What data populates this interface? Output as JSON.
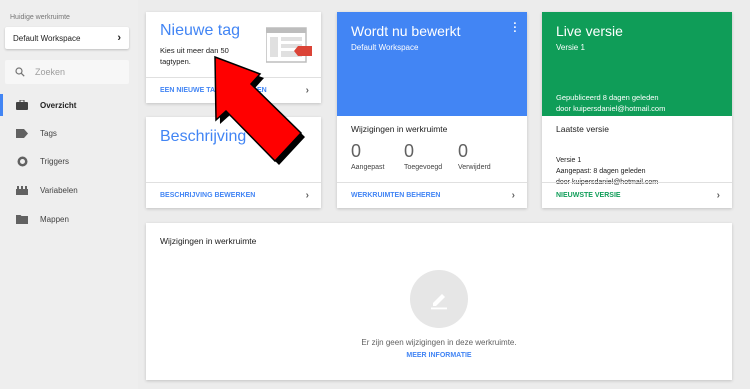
{
  "sidebar": {
    "workspace_label": "Huidige werkruimte",
    "workspace_name": "Default Workspace",
    "search_placeholder": "Zoeken",
    "items": [
      {
        "label": "Overzicht",
        "icon": "briefcase-icon"
      },
      {
        "label": "Tags",
        "icon": "tag-icon"
      },
      {
        "label": "Triggers",
        "icon": "trigger-icon"
      },
      {
        "label": "Variabelen",
        "icon": "variables-icon"
      },
      {
        "label": "Mappen",
        "icon": "folder-icon"
      }
    ]
  },
  "new_tag": {
    "title": "Nieuwe tag",
    "description": "Kies uit meer dan 50 tagtypen.",
    "footer": "EEN NIEUWE TAG TOEVOEGEN"
  },
  "description_card": {
    "title": "Beschrijving",
    "footer": "BESCHRIJVING BEWERKEN"
  },
  "editing_card": {
    "title": "Wordt nu bewerkt",
    "subtitle": "Default Workspace",
    "section_title": "Wijzigingen in werkruimte",
    "stats": [
      {
        "value": "0",
        "label": "Aangepast"
      },
      {
        "value": "0",
        "label": "Toegevoegd"
      },
      {
        "value": "0",
        "label": "Verwijderd"
      }
    ],
    "footer": "WERKRUIMTEN BEHEREN"
  },
  "live_card": {
    "title": "Live versie",
    "subtitle": "Versie 1",
    "published": "Gepubliceerd 8 dagen geleden",
    "published_by": "door kuipersdaniel@hotmail.com",
    "section_title": "Laatste versie",
    "version": "Versie 1",
    "modified": "Aangepast: 8 dagen geleden",
    "modified_by": "door kuipersdaniel@hotmail.com",
    "footer": "NIEUWSTE VERSIE"
  },
  "changes_card": {
    "title": "Wijzigingen in werkruimte",
    "empty_text": "Er zijn geen wijzigingen in deze werkruimte.",
    "link": "MEER INFORMATIE"
  },
  "colors": {
    "accent_blue": "#4285f4",
    "live_green": "#0f9d58",
    "arrow_red": "#ff0000"
  }
}
